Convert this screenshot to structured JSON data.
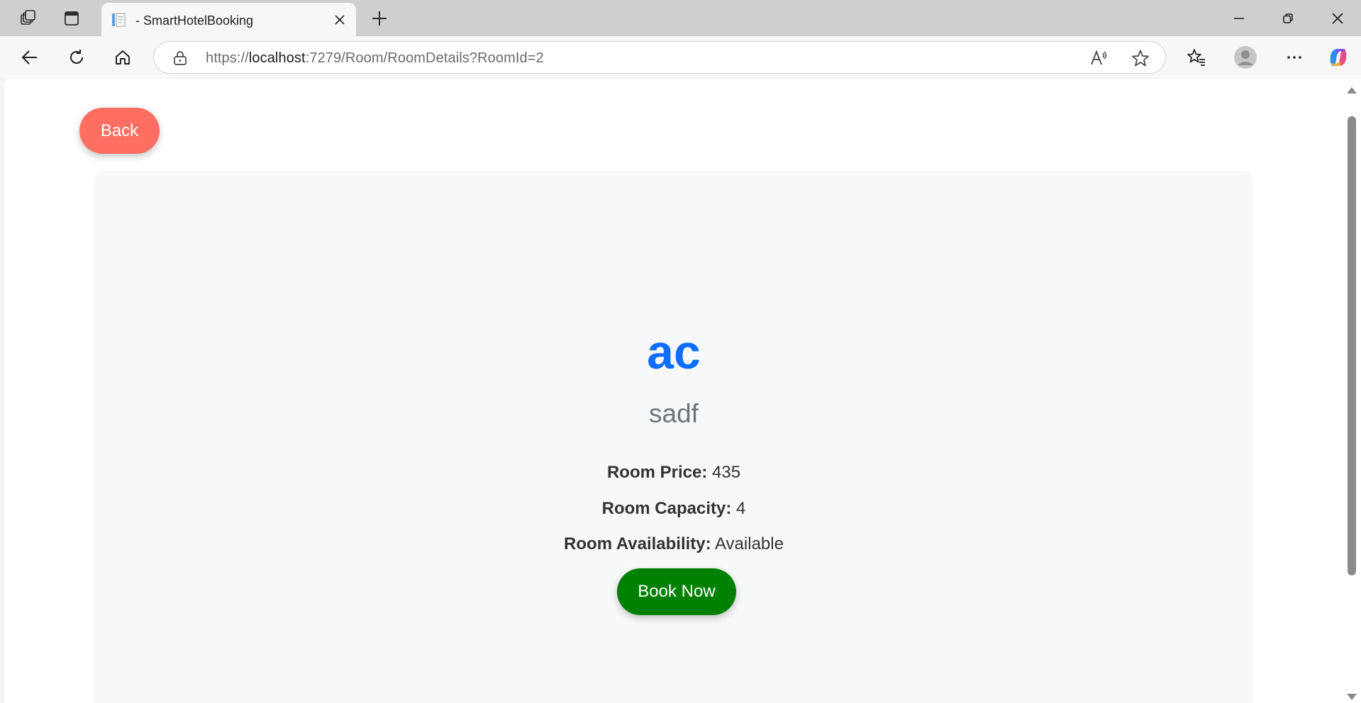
{
  "browser": {
    "tab_title": "- SmartHotelBooking",
    "url_scheme": "https://",
    "url_host": "localhost",
    "url_rest": ":7279/Room/RoomDetails?RoomId=2",
    "icons": [
      "workspaces-icon",
      "tab-actions-icon",
      "favicon-icon",
      "close-tab-icon",
      "new-tab-icon",
      "minimize-icon",
      "restore-icon",
      "close-window-icon",
      "back-icon",
      "refresh-icon",
      "home-icon",
      "lock-icon",
      "read-aloud-icon",
      "favorite-star-icon",
      "favorites-icon",
      "profile-avatar-icon",
      "more-icon",
      "copilot-icon"
    ]
  },
  "page": {
    "back_label": "Back",
    "room_name": "ac",
    "room_description": "sadf",
    "details": [
      {
        "label": "Room Price:",
        "value": "435"
      },
      {
        "label": "Room Capacity:",
        "value": "4"
      },
      {
        "label": "Room Availability:",
        "value": "Available"
      }
    ],
    "book_label": "Book Now"
  },
  "colors": {
    "back_button": "#ff6f61",
    "book_button": "#008000",
    "room_name": "#0d6efd",
    "room_description": "#6c757d",
    "card_background": "#f7f8fa"
  }
}
